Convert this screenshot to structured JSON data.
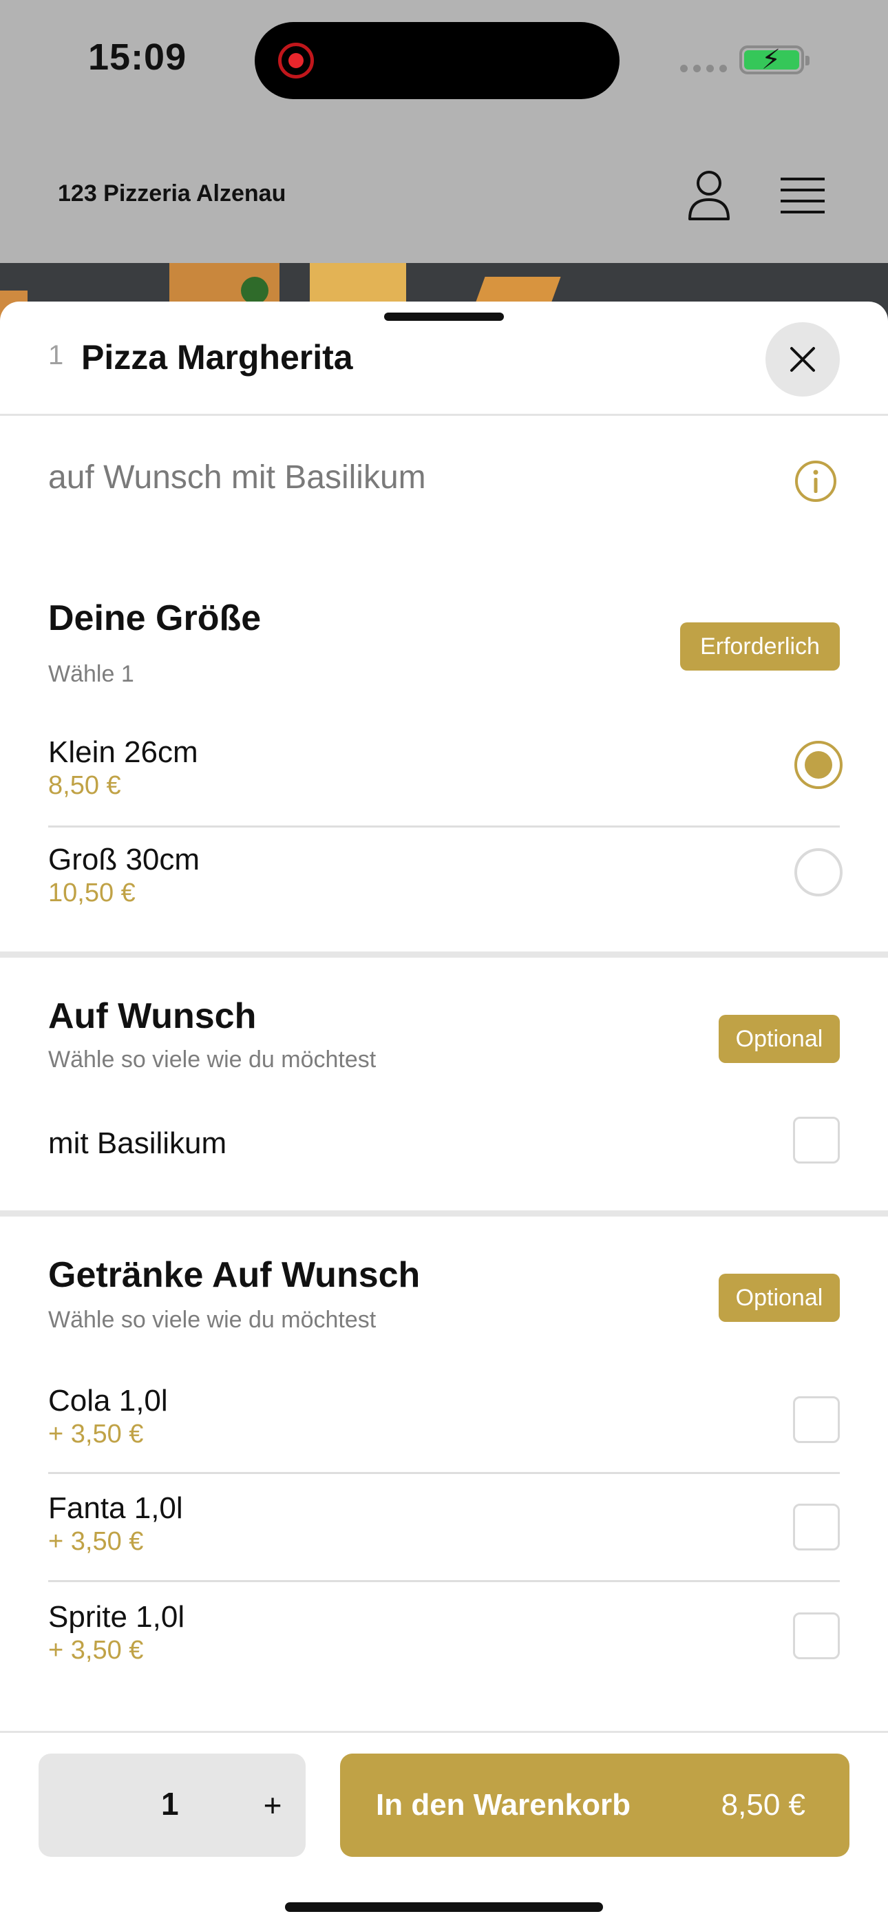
{
  "status_bar": {
    "time": "15:09"
  },
  "header": {
    "brand": "123 Pizzeria Alzenau",
    "user_icon": "user-icon",
    "menu_icon": "hamburger-menu-icon"
  },
  "item": {
    "number": "1",
    "title": "Pizza Margherita",
    "description": "auf Wunsch mit Basilikum"
  },
  "sections": [
    {
      "title": "Deine Größe",
      "subtitle": "Wähle 1",
      "badge": "Erforderlich",
      "options": [
        {
          "label": "Klein 26cm",
          "price": "8,50 €",
          "selected": true
        },
        {
          "label": "Groß 30cm",
          "price": "10,50 €",
          "selected": false
        }
      ]
    },
    {
      "title": "Auf Wunsch",
      "subtitle": "Wähle so viele wie du möchtest",
      "badge": "Optional",
      "options": [
        {
          "label": "mit Basilikum",
          "checked": false
        }
      ]
    },
    {
      "title": "Getränke Auf Wunsch",
      "subtitle": "Wähle so viele wie du möchtest",
      "badge": "Optional",
      "options": [
        {
          "label": "Cola 1,0l",
          "price": "+ 3,50 €",
          "checked": false
        },
        {
          "label": "Fanta 1,0l",
          "price": "+ 3,50 €",
          "checked": false
        },
        {
          "label": "Sprite 1,0l",
          "price": "+ 3,50 €",
          "checked": false
        }
      ]
    }
  ],
  "footer": {
    "quantity": "1",
    "plus": "+",
    "cart_label": "In den Warenkorb",
    "cart_price": "8,50 €"
  },
  "colors": {
    "accent": "#c0a246",
    "badge_text": "#ffffff",
    "divider": "#dedede"
  }
}
